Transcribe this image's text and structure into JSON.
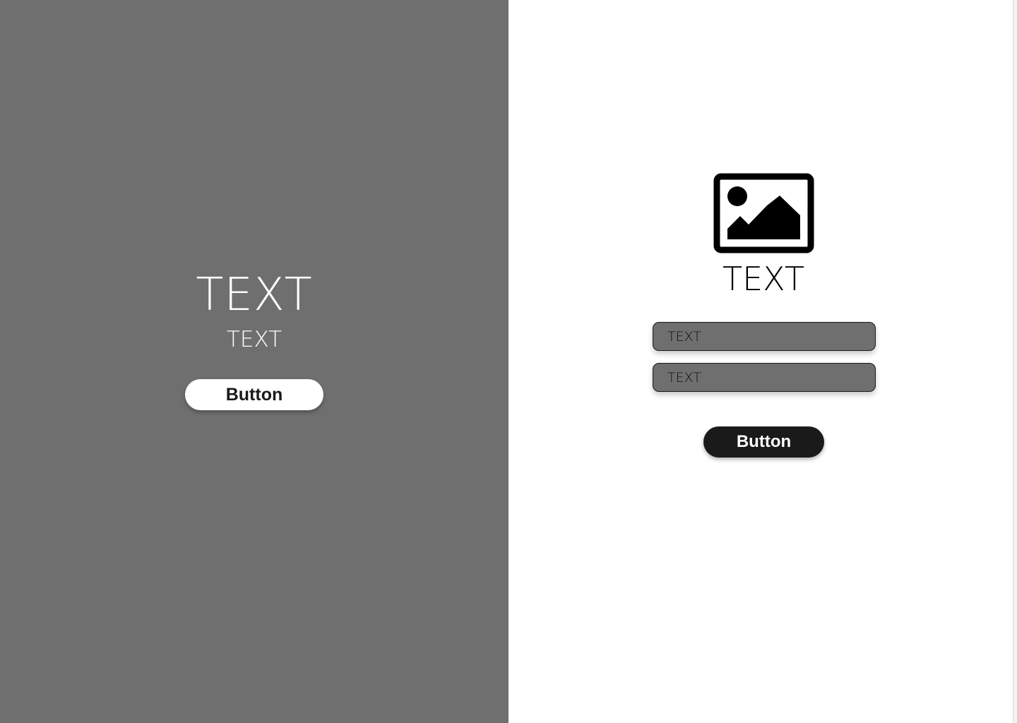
{
  "left_panel": {
    "title": "TEXT",
    "subtitle": "TEXT",
    "button_label": "Button"
  },
  "right_panel": {
    "image_icon": "image-placeholder-icon",
    "title": "TEXT",
    "fields": [
      {
        "placeholder": "TEXT"
      },
      {
        "placeholder": "TEXT"
      }
    ],
    "button_label": "Button"
  },
  "colors": {
    "left_panel_bg": "#6f6f6f",
    "right_panel_bg": "#ffffff",
    "field_bg": "#6f6f6f",
    "left_button_bg": "#ffffff",
    "right_button_bg": "#1a1a1a"
  }
}
